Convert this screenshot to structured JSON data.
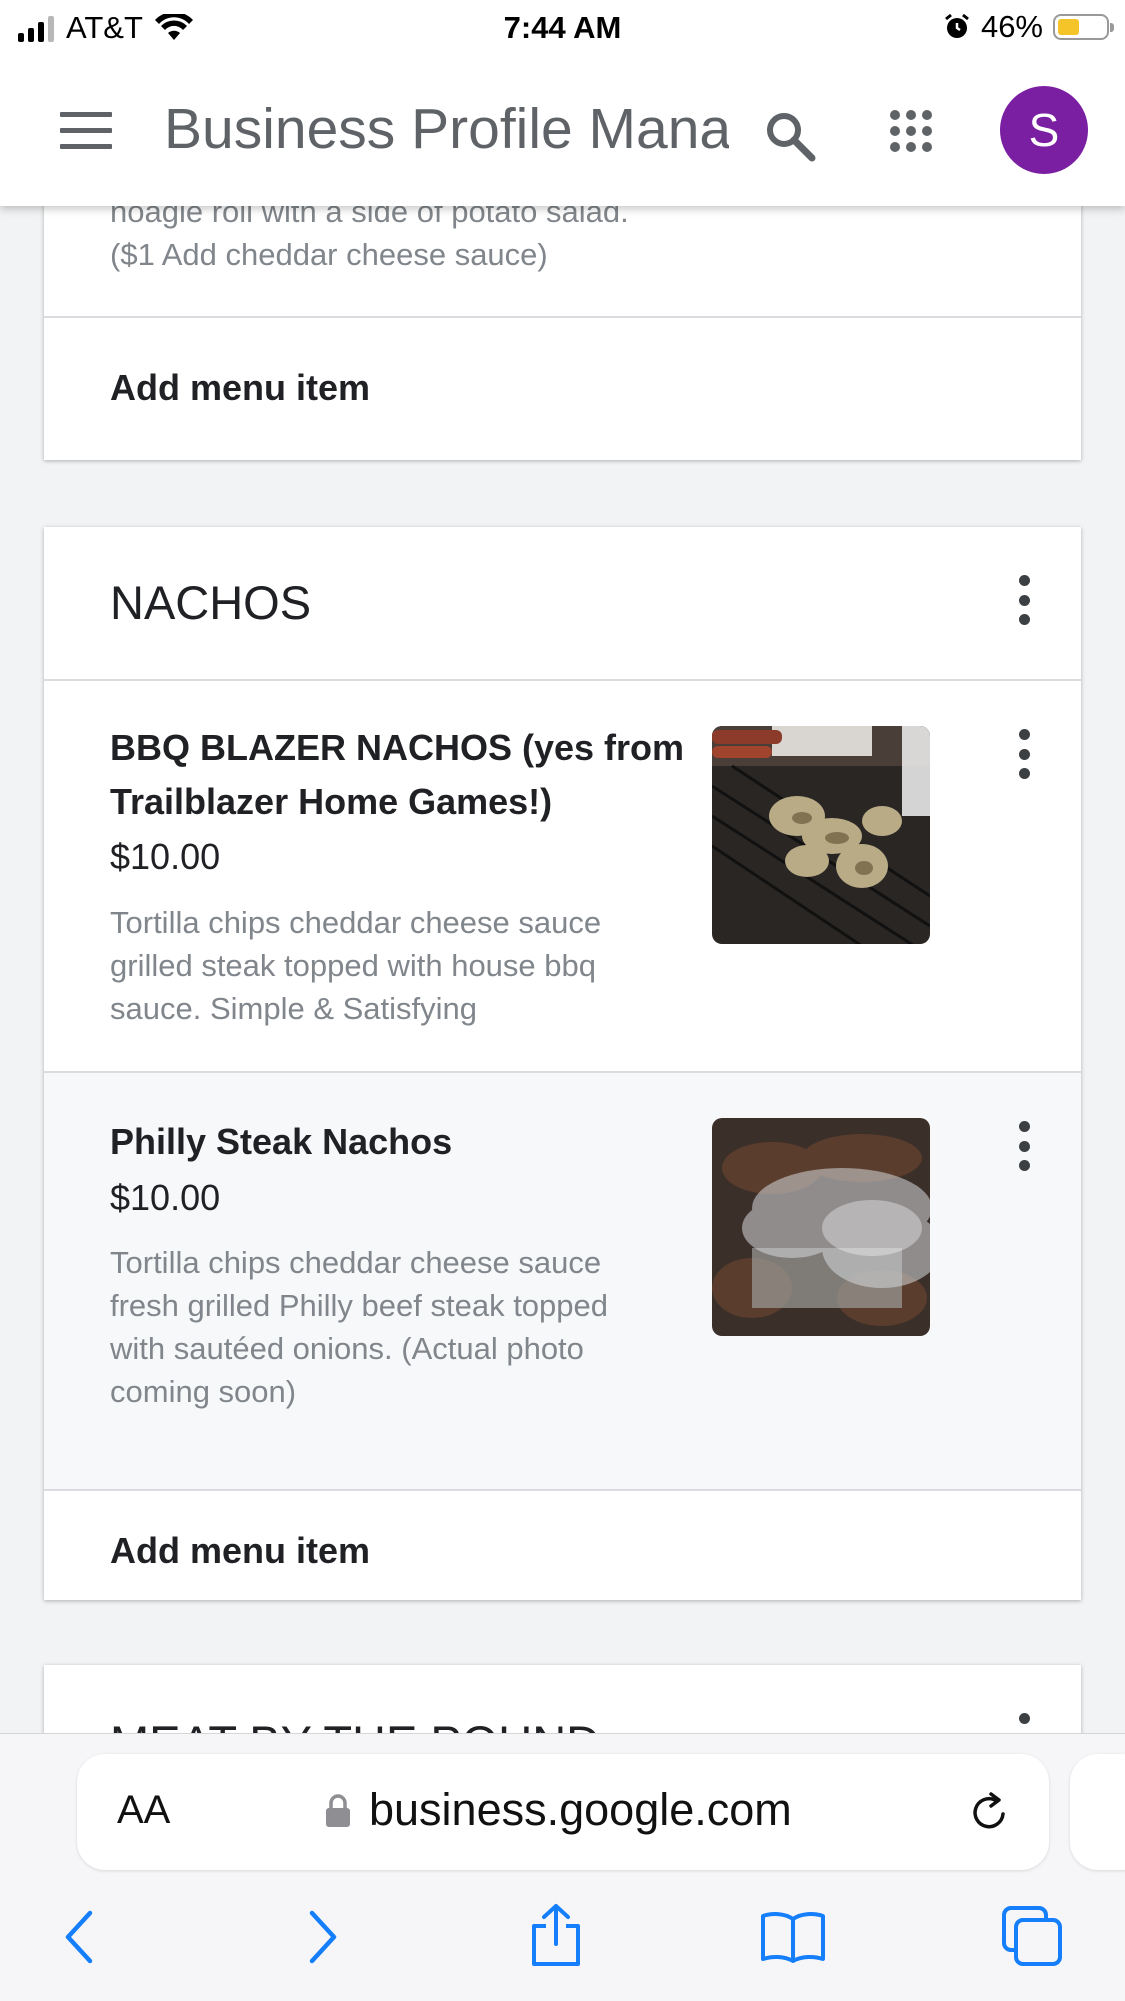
{
  "status_bar": {
    "carrier": "AT&T",
    "time": "7:44 AM",
    "battery_percent": "46%",
    "battery_level": 0.46,
    "signal_bars_on": 3,
    "signal_bars_total": 4
  },
  "app_bar": {
    "title": "Business Profile Manager",
    "avatar_initial": "S",
    "avatar_color": "#7b1fa2"
  },
  "previous_section": {
    "truncated_description_line1": "noagle roll with a side of potato salad.",
    "truncated_description_line2": "($1 Add cheddar cheese sauce)",
    "add_item_label": "Add menu item"
  },
  "nachos_section": {
    "title": "NACHOS",
    "items": [
      {
        "name": "BBQ BLAZER NACHOS (yes from Trailblazer Home Games!)",
        "price": "$10.00",
        "description": "Tortilla chips cheddar cheese sauce grilled steak topped with house bbq sauce. Simple & Satisfying",
        "image": "grilled-chicken-photo"
      },
      {
        "name": "Philly Steak Nachos",
        "price": "$10.00",
        "description": "Tortilla chips cheddar cheese sauce fresh grilled Philly beef steak topped with sautéed onions. (Actual photo coming soon)",
        "image": "smoky-grill-photo"
      }
    ],
    "add_item_label": "Add menu item"
  },
  "next_section": {
    "title_partial": "MEAT BY THE POUND"
  },
  "browser": {
    "text_size_label": "AA",
    "url": "business.google.com"
  },
  "icons": {
    "menu": "hamburger-menu-icon",
    "search": "search-icon",
    "apps": "apps-grid-icon",
    "more": "more-vert-icon",
    "lock": "lock-icon",
    "reload": "reload-icon",
    "back": "back-chevron-icon",
    "forward": "forward-chevron-icon",
    "share": "share-icon",
    "bookmarks": "bookmarks-book-icon",
    "tabs": "tabs-icon"
  },
  "colors": {
    "accent_ios": "#147efb",
    "text_secondary": "#80868b",
    "selected_row_bg": "#f7f8fa"
  }
}
